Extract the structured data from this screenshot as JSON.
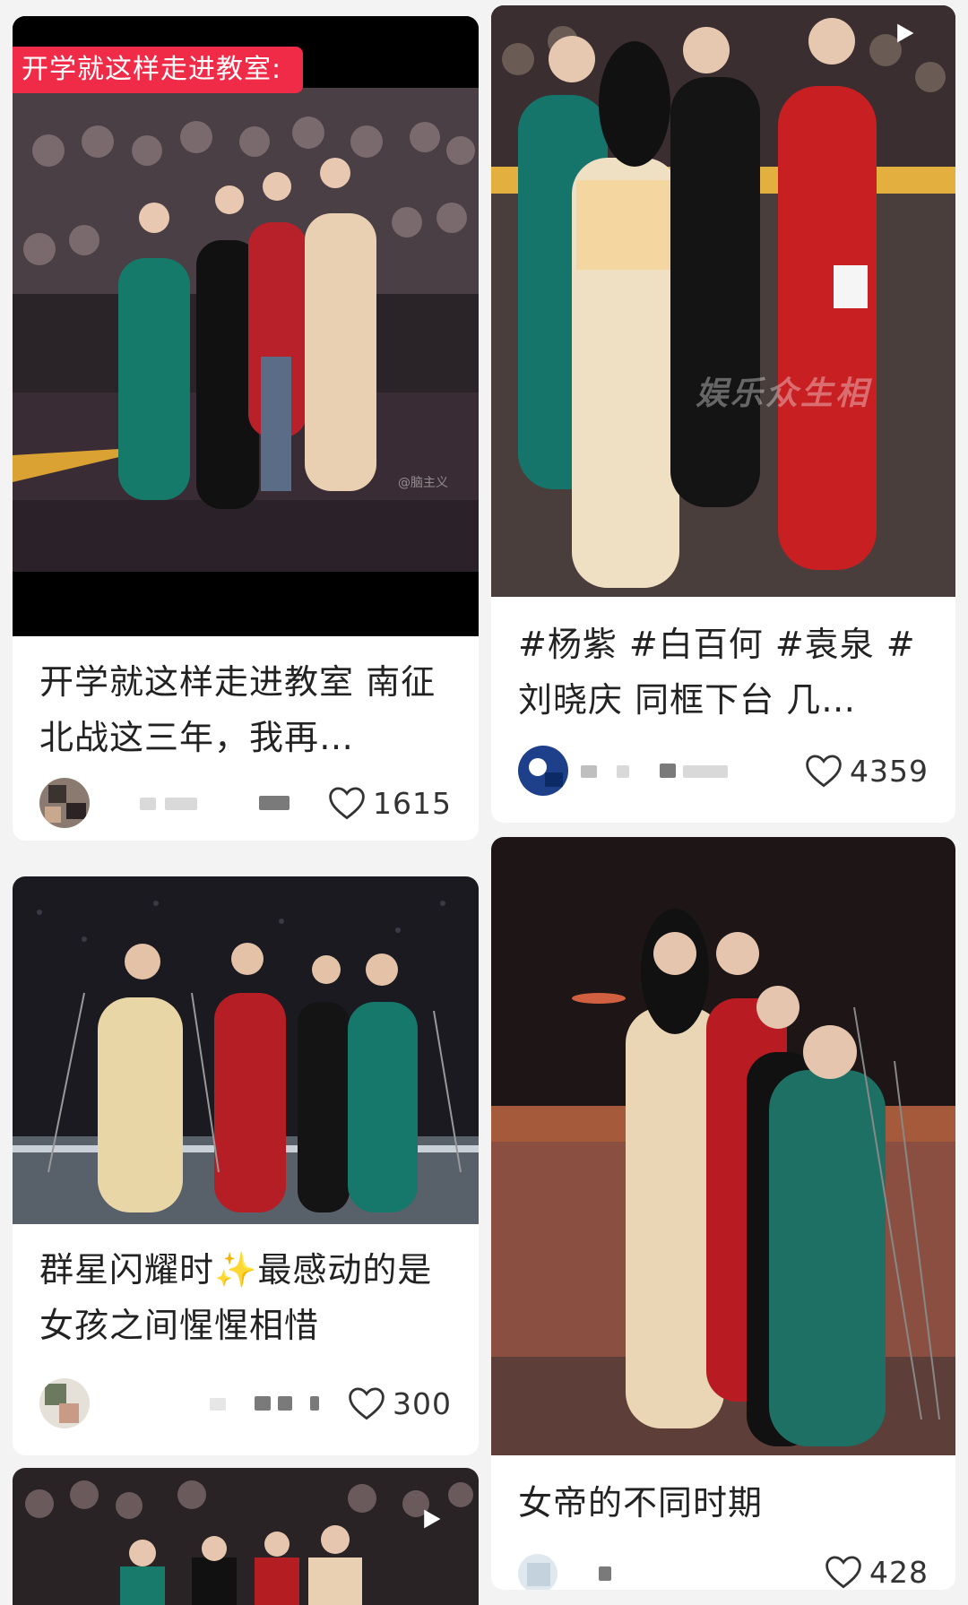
{
  "feed": [
    {
      "overlay": "开学就这样走进教室:",
      "watermark": "@脑主义",
      "title": "开学就这样走进教室 南征北战这三年，我再…",
      "likes": "1615"
    },
    {
      "watermark": "娱乐众生相",
      "title": "#杨紫 #白百何 #袁泉 #刘晓庆 同框下台 几…",
      "likes": "4359"
    },
    {
      "title": "群星闪耀时✨最感动的是女孩之间惺惺相惜",
      "likes": "300"
    },
    {
      "title": "女帝的不同时期",
      "likes": "428"
    },
    {}
  ],
  "colors": {
    "accent": "#ef2b48",
    "like_outline": "#333333"
  },
  "icons": {
    "like": "heart-outline-icon",
    "video": "play-icon"
  }
}
